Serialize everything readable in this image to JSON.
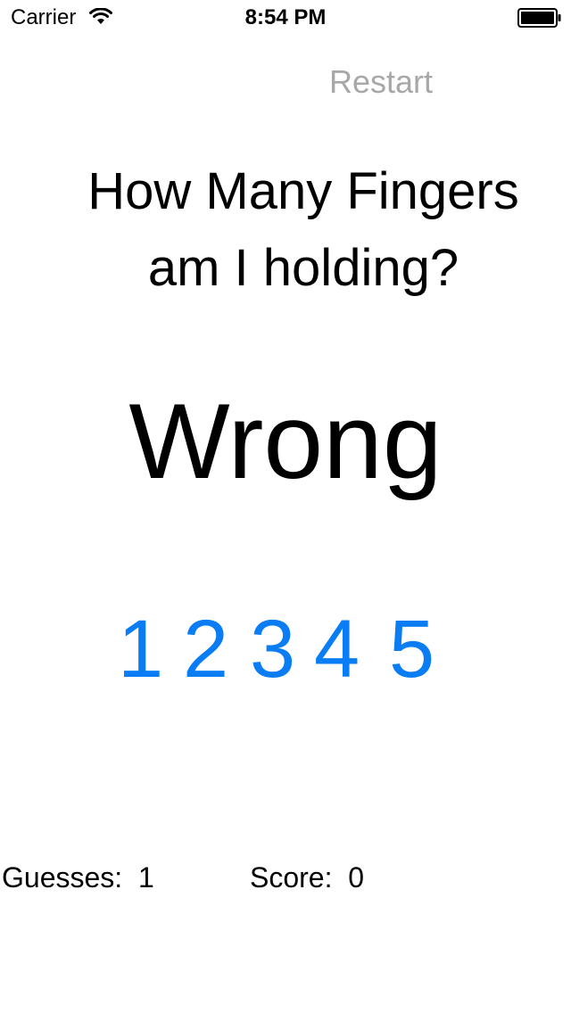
{
  "status_bar": {
    "carrier": "Carrier",
    "time": "8:54 PM",
    "icons": [
      "wifi-icon",
      "battery-icon"
    ]
  },
  "toolbar": {
    "restart_label": "Restart",
    "restart_color": "#a8a8a8"
  },
  "question": {
    "line1": "How Many Fingers",
    "line2": "am I holding?"
  },
  "result": {
    "text": "Wrong"
  },
  "choices": {
    "color": "#0a7df5",
    "items": [
      "1",
      "2",
      "3",
      "4",
      "5"
    ]
  },
  "stats": {
    "guesses_label": "Guesses:",
    "guesses_value": "1",
    "score_label": "Score:",
    "score_value": "0"
  }
}
